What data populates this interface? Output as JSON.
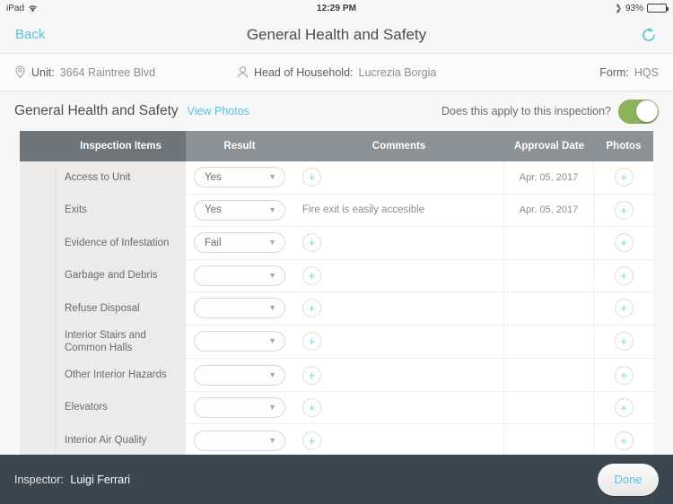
{
  "status_bar": {
    "device": "iPad",
    "wifi_icon": "wifi-icon",
    "time": "12:29 PM",
    "bluetooth_icon": "bluetooth-icon",
    "battery_percent": "93%"
  },
  "nav": {
    "back_label": "Back",
    "title": "General Health and Safety",
    "refresh_icon": "refresh-icon"
  },
  "info_bar": {
    "unit_icon": "location-pin-icon",
    "unit_label": "Unit:",
    "unit_value": "3664 Raintree Blvd",
    "hoh_icon": "person-icon",
    "hoh_label": "Head of Household:",
    "hoh_value": "Lucrezia Borgia",
    "form_label": "Form:",
    "form_value": "HQS"
  },
  "section": {
    "title": "General Health and Safety",
    "view_photos_label": "View Photos",
    "toggle_label": "Does this apply to this inspection?",
    "toggle_state": "on",
    "toggle_on_color": "#8cb35c"
  },
  "table": {
    "headers": {
      "gutter": "",
      "items": "Inspection Items",
      "result": "Result",
      "comments": "Comments",
      "approval": "Approval Date",
      "photos": "Photos"
    },
    "rows": [
      {
        "item": "Access to Unit",
        "result": "Yes",
        "comment": "",
        "approval": "Apr. 05, 2017"
      },
      {
        "item": "Exits",
        "result": "Yes",
        "comment": "Fire exit is easily accesible",
        "approval": "Apr. 05, 2017"
      },
      {
        "item": "Evidence of Infestation",
        "result": "Fail",
        "comment": "",
        "approval": ""
      },
      {
        "item": "Garbage and Debris",
        "result": "",
        "comment": "",
        "approval": ""
      },
      {
        "item": "Refuse Disposal",
        "result": "",
        "comment": "",
        "approval": ""
      },
      {
        "item": "Interior Stairs and Common Halls",
        "result": "",
        "comment": "",
        "approval": ""
      },
      {
        "item": "Other Interior Hazards",
        "result": "",
        "comment": "",
        "approval": ""
      },
      {
        "item": "Elevators",
        "result": "",
        "comment": "",
        "approval": ""
      },
      {
        "item": "Interior Air Quality",
        "result": "",
        "comment": "",
        "approval": ""
      }
    ],
    "add_icon": "plus-icon",
    "chevron_icon": "chevron-down-icon"
  },
  "bottom_bar": {
    "inspector_label": "Inspector:",
    "inspector_value": "Luigi Ferrari",
    "done_label": "Done"
  },
  "colors": {
    "accent": "#53c3e0",
    "header_dark": "#6e757a",
    "header_light": "#8a9197",
    "bottom_bar": "#3a4750"
  }
}
